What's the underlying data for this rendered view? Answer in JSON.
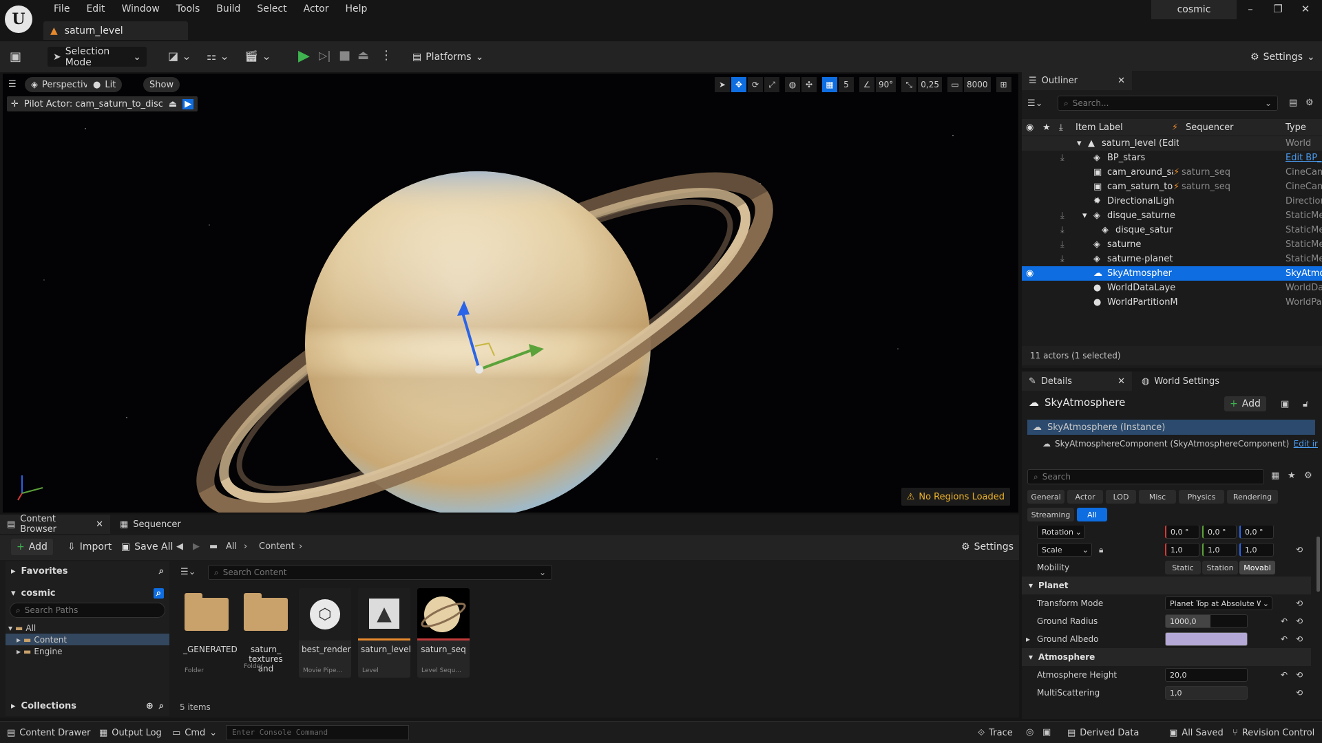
{
  "titlebar": {
    "menu": [
      "File",
      "Edit",
      "Window",
      "Tools",
      "Build",
      "Select",
      "Actor",
      "Help"
    ],
    "doc_tab": "saturn_level",
    "project": "cosmic"
  },
  "toolbar": {
    "mode": "Selection Mode",
    "platforms": "Platforms",
    "settings": "Settings"
  },
  "viewport": {
    "perspective": "Perspective",
    "lit": "Lit",
    "show": "Show",
    "pilot": "Pilot Actor: cam_saturn_to_disc",
    "snap_grid": "5",
    "snap_angle": "90°",
    "snap_scale": "0,25",
    "camera_speed": "8000",
    "no_regions": "No Regions Loaded"
  },
  "content_browser": {
    "tab": "Content Browser",
    "tab2": "Sequencer",
    "add": "Add",
    "import": "Import",
    "save_all": "Save All",
    "crumb_all": "All",
    "crumb_content": "Content",
    "settings": "Settings",
    "favorites": "Favorites",
    "project": "cosmic",
    "search_paths": "Search Paths",
    "tree": [
      "All",
      "Content",
      "Engine"
    ],
    "collections": "Collections",
    "search_content": "Search Content",
    "count": "5 items",
    "assets": [
      {
        "name": "_GENERATED",
        "type": "Folder"
      },
      {
        "name": "saturn_\ntextures and",
        "type": "Folder"
      },
      {
        "name": "best_render",
        "type": "Movie Pipe..."
      },
      {
        "name": "saturn_level",
        "type": "Level"
      },
      {
        "name": "saturn_seq",
        "type": "Level Sequ..."
      }
    ]
  },
  "outliner": {
    "title": "Outliner",
    "search": "Search...",
    "col_label": "Item Label",
    "col_seq": "Sequencer",
    "col_type": "Type",
    "rows": [
      {
        "label": "saturn_level (Edit",
        "seq": "",
        "type": "World"
      },
      {
        "label": "BP_stars",
        "seq": "",
        "type": "Edit BP_"
      },
      {
        "label": "cam_around_sa",
        "seq": "saturn_seq",
        "type": "CineCam"
      },
      {
        "label": "cam_saturn_to",
        "seq": "saturn_seq",
        "type": "CineCam"
      },
      {
        "label": "DirectionalLigh",
        "seq": "",
        "type": "Direction"
      },
      {
        "label": "disque_saturne",
        "seq": "",
        "type": "StaticMe"
      },
      {
        "label": "disque_satur",
        "seq": "",
        "type": "StaticMe"
      },
      {
        "label": "saturne",
        "seq": "",
        "type": "StaticMe"
      },
      {
        "label": "saturne-planet",
        "seq": "",
        "type": "StaticMe"
      },
      {
        "label": "SkyAtmospher",
        "seq": "",
        "type": "SkyAtmo"
      },
      {
        "label": "WorldDataLaye",
        "seq": "",
        "type": "WorldDa"
      },
      {
        "label": "WorldPartitionM",
        "seq": "",
        "type": "WorldPa"
      }
    ],
    "footer": "11 actors (1 selected)"
  },
  "details": {
    "tab": "Details",
    "tab2": "World Settings",
    "actor": "SkyAtmosphere",
    "add": "Add",
    "instance": "SkyAtmosphere (Instance)",
    "component": "SkyAtmosphereComponent (SkyAtmosphereComponent)",
    "edit_in": "Edit ir",
    "search": "Search",
    "cats": [
      "General",
      "Actor",
      "LOD",
      "Misc",
      "Physics",
      "Rendering",
      "Streaming",
      "All"
    ],
    "rotation_label": "Rotation",
    "rot": [
      "0,0 °",
      "0,0 °",
      "0,0 °"
    ],
    "scale_label": "Scale",
    "scale": [
      "1,0",
      "1,0",
      "1,0"
    ],
    "mobility": "Mobility",
    "mob_opts": [
      "Static",
      "Station",
      "Movabl"
    ],
    "planet": "Planet",
    "transform_mode": "Transform Mode",
    "transform_mode_val": "Planet Top at Absolute W",
    "ground_radius": "Ground Radius",
    "ground_radius_val": "1000,0",
    "ground_albedo": "Ground Albedo",
    "atmosphere": "Atmosphere",
    "atmo_height": "Atmosphere Height",
    "atmo_height_val": "20,0",
    "multiscatter": "MultiScattering",
    "multiscatter_val": "1,0",
    "albedo_color": "#b4a8d6"
  },
  "statusbar": {
    "drawer": "Content Drawer",
    "output": "Output Log",
    "cmd": "Cmd",
    "console": "Enter Console Command",
    "trace": "Trace",
    "derived": "Derived Data",
    "saved": "All Saved",
    "revision": "Revision Control"
  }
}
